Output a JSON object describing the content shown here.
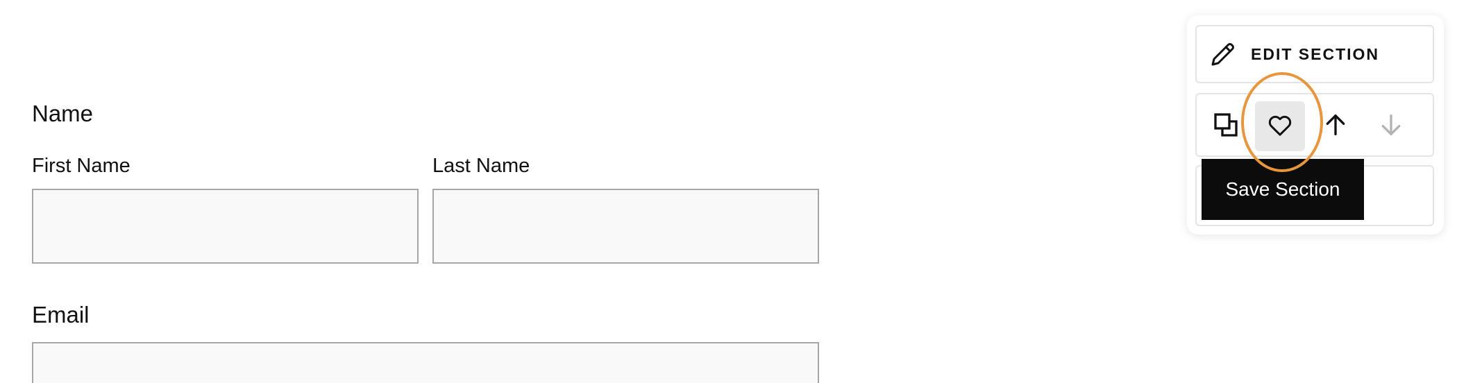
{
  "form": {
    "name_heading": "Name",
    "first_name_label": "First Name",
    "last_name_label": "Last Name",
    "first_name_value": "",
    "last_name_value": "",
    "email_heading": "Email",
    "email_value": ""
  },
  "section_panel": {
    "edit_section_label": "EDIT SECTION",
    "actions": [
      {
        "icon": "duplicate-icon",
        "state": "enabled"
      },
      {
        "icon": "heart-icon",
        "state": "hovered"
      },
      {
        "icon": "arrow-up-icon",
        "state": "enabled"
      },
      {
        "icon": "arrow-down-icon",
        "state": "disabled"
      }
    ],
    "tooltip": "Save Section",
    "highlight_color": "#e8963b"
  },
  "colors": {
    "input_background": "#f9f9f9",
    "input_border": "#a6a6a6",
    "tooltip_background": "#0c0c0c",
    "disabled_icon": "#b3b3b3"
  }
}
